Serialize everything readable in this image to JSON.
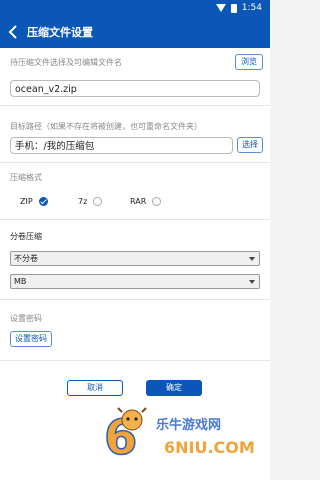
{
  "status": {
    "time": "1:54"
  },
  "appbar": {
    "title": "压缩文件设置"
  },
  "file": {
    "label": "待压缩文件选择及可编辑文件名",
    "browse": "浏览",
    "value": "ocean_v2.zip"
  },
  "target": {
    "label": "目标路径（如果不存在将被创建，也可重命名文件夹）",
    "value": "手机：/我的压缩包",
    "select": "选择"
  },
  "format": {
    "label": "压缩格式",
    "options": [
      {
        "label": "ZIP",
        "checked": true
      },
      {
        "label": "7z",
        "checked": false
      },
      {
        "label": "RAR",
        "checked": false
      }
    ]
  },
  "split": {
    "label": "分卷压缩",
    "select_value": "不分卷",
    "unit_value": "MB"
  },
  "password": {
    "label": "设置密码",
    "button": "设置密码"
  },
  "actions": {
    "cancel": "取消",
    "ok": "确定"
  },
  "watermark": {
    "line1": "乐牛游戏网",
    "line2": "6NIU.COM"
  },
  "colors": {
    "primary": "#0b57b7",
    "background": "#ffffff"
  }
}
